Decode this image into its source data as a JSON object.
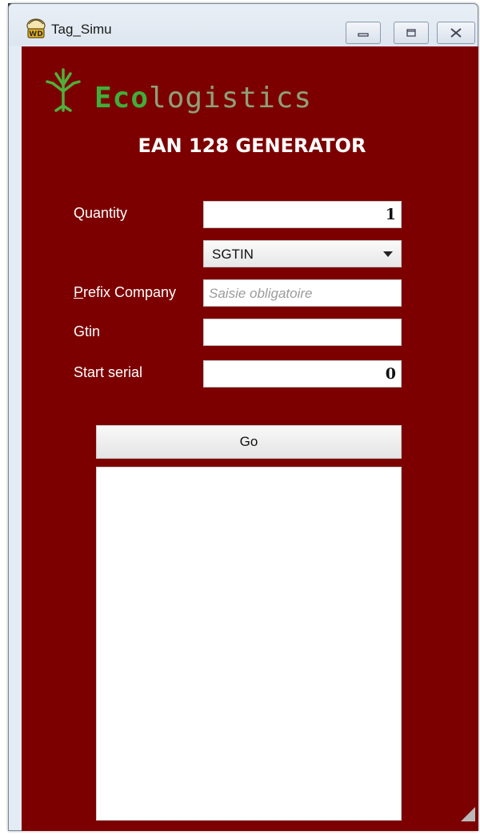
{
  "window": {
    "title": "Tag_Simu",
    "icon": "wd-app-icon"
  },
  "header": {
    "logo_brand": "Eco",
    "logo_rest": "logistics",
    "heading": "EAN 128 GENERATOR"
  },
  "form": {
    "quantity_label": "Quantity",
    "quantity_value": "1",
    "type_selected": "SGTIN",
    "prefix_label_first": "P",
    "prefix_label_rest": "refix Company",
    "prefix_placeholder": "Saisie obligatoire",
    "gtin_label": "Gtin",
    "gtin_value": "",
    "start_serial_label": "Start serial",
    "start_serial_value": "0"
  },
  "actions": {
    "go_label": "Go"
  },
  "colors": {
    "background": "#7d0000",
    "logo_green": "#3fae3a",
    "logo_gray": "#8ea07a"
  }
}
